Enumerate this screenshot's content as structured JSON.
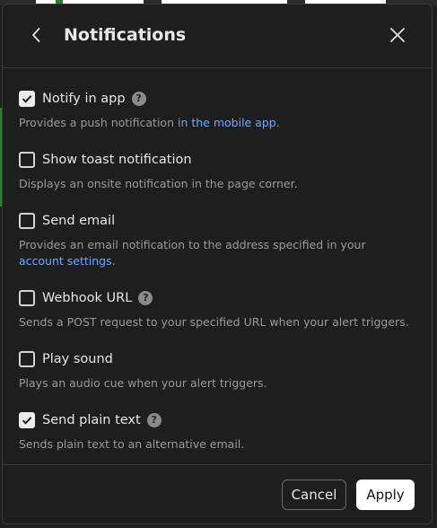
{
  "dialog": {
    "title": "Notifications",
    "back_icon": "chevron-left-icon",
    "close_icon": "close-icon"
  },
  "options": [
    {
      "label": "Notify in app",
      "checked": true,
      "has_help": true,
      "help_glyph": "?",
      "desc_pre": "Provides a push notification ",
      "desc_link": "in the mobile app",
      "desc_post": "."
    },
    {
      "label": "Show toast notification",
      "checked": false,
      "has_help": false,
      "desc": "Displays an onsite notification in the page corner."
    },
    {
      "label": "Send email",
      "checked": false,
      "has_help": false,
      "desc_pre": "Provides an email notification to the address specified in your ",
      "desc_link": "account settings",
      "desc_post": "."
    },
    {
      "label": "Webhook URL",
      "checked": false,
      "has_help": true,
      "help_glyph": "?",
      "desc": "Sends a POST request to your specified URL when your alert triggers."
    },
    {
      "label": "Play sound",
      "checked": false,
      "has_help": false,
      "desc": "Plays an audio cue when your alert triggers."
    },
    {
      "label": "Send plain text",
      "checked": true,
      "has_help": true,
      "help_glyph": "?",
      "desc": "Sends plain text to an alternative email."
    }
  ],
  "footer": {
    "cancel_label": "Cancel",
    "apply_label": "Apply"
  },
  "colors": {
    "background": "#1e1e1e",
    "link": "#6fa8ff",
    "checked_fill": "#ececec"
  }
}
